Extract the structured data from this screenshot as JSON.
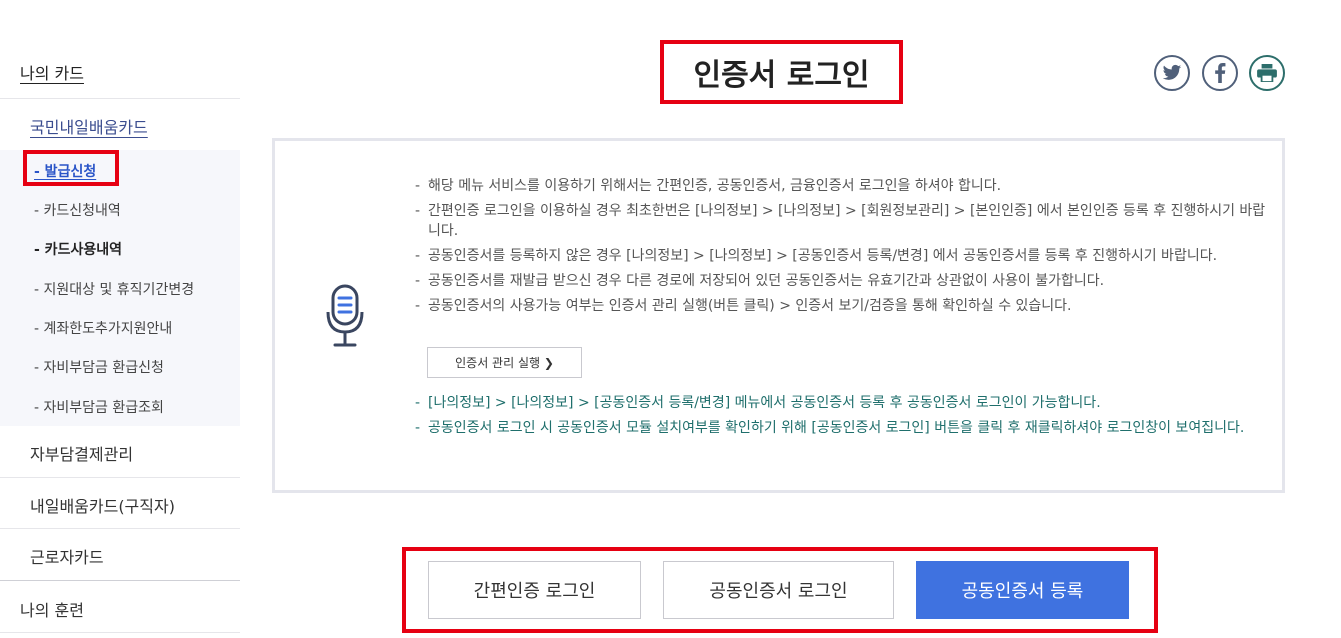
{
  "sidebar": {
    "title": "나의 카드",
    "section": "국민내일배움카드",
    "sub_items": [
      {
        "label": "- 발급신청"
      },
      {
        "label": "- 카드신청내역"
      },
      {
        "label": "- 카드사용내역"
      },
      {
        "label": "- 지원대상 및 휴직기간변경"
      },
      {
        "label": "- 계좌한도추가지원안내"
      },
      {
        "label": "- 자비부담금 환급신청"
      },
      {
        "label": "- 자비부담금 환급조회"
      }
    ],
    "items": [
      {
        "label": "자부담결제관리"
      },
      {
        "label": "내일배움카드(구직자)"
      },
      {
        "label": "근로자카드"
      }
    ],
    "bottom": "나의 훈련"
  },
  "page": {
    "title": "인증서 로그인"
  },
  "share": {
    "twitter": "twitter-icon",
    "facebook": "facebook-icon",
    "print": "print-icon"
  },
  "info": {
    "lines": [
      "해당 메뉴 서비스를 이용하기 위해서는 간편인증, 공동인증서, 금융인증서 로그인을 하셔야 합니다.",
      "간편인증 로그인을 이용하실 경우 최초한번은 [나의정보] > [나의정보] > [회원정보관리] > [본인인증] 에서 본인인증 등록 후 진행하시기 바랍니다.",
      "공동인증서를 등록하지 않은 경우 [나의정보] > [나의정보] > [공동인증서 등록/변경] 에서 공동인증서를 등록 후 진행하시기 바랍니다.",
      "공동인증서를 재발급 받으신 경우 다른 경로에 저장되어 있던 공동인증서는 유효기간과 상관없이 사용이 불가합니다.",
      "공동인증서의 사용가능 여부는 인증서 관리 실행(버튼 클릭) > 인증서 보기/검증을 통해 확인하실 수 있습니다."
    ],
    "mgmt_button": "인증서 관리 실행 ❯",
    "notes": [
      "[나의정보] > [나의정보] > [공동인증서 등록/변경] 메뉴에서 공동인증서 등록 후 공동인증서 로그인이 가능합니다.",
      "공동인증서 로그인 시 공동인증서 모듈 설치여부를 확인하기 위해 [공동인증서 로그인] 버튼을 클릭 후 재클릭하셔야 로그인창이 보여집니다."
    ]
  },
  "buttons": {
    "simple_login": "간편인증 로그인",
    "cert_login": "공동인증서 로그인",
    "cert_register": "공동인증서 등록"
  },
  "colors": {
    "highlight": "#e60012",
    "primary": "#3f72e0",
    "note_text": "#1f6f6c"
  }
}
